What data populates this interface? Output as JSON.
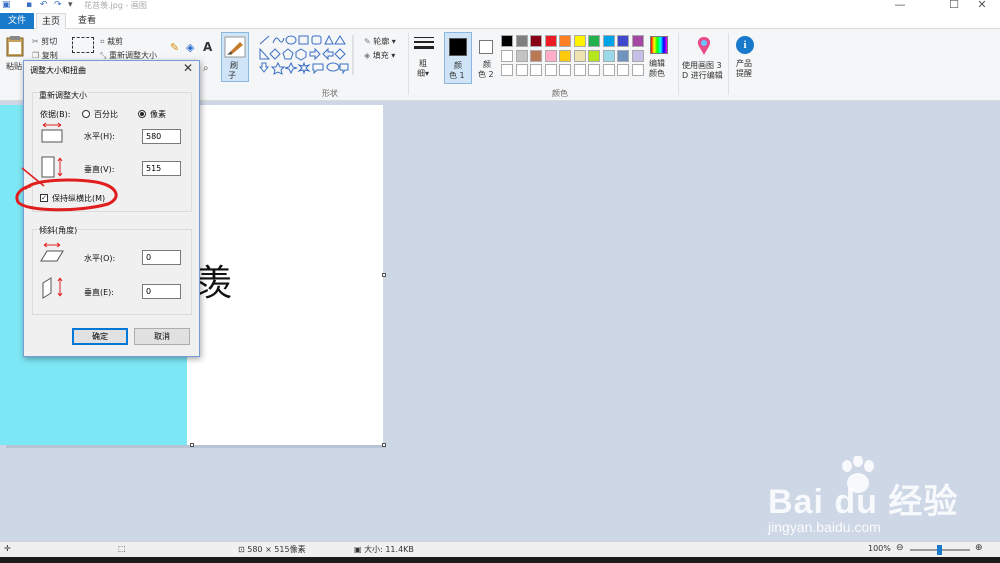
{
  "window": {
    "title": "花苔羡.jpg - 画图",
    "controls": {
      "minimize": "—",
      "maximize": "☐",
      "close": "✕"
    }
  },
  "tabs": [
    {
      "label": "文件"
    },
    {
      "label": "主页"
    },
    {
      "label": "查看"
    }
  ],
  "ribbon": {
    "clipboard": {
      "paste": "粘贴",
      "cut": "剪切",
      "copy": "复制"
    },
    "image": {
      "crop": "裁剪",
      "resize": "重新调整大小"
    },
    "brush": {
      "label": "刷",
      "label2": "子"
    },
    "shapes": {
      "group": "形状",
      "outline": "轮廓",
      "fill": "填充"
    },
    "size": {
      "label": "粗",
      "label2": "细"
    },
    "color1": {
      "label": "颜",
      "label2": "色 1"
    },
    "color2": {
      "label": "颜",
      "label2": "色 2"
    },
    "colors_group": "颜色",
    "edit_colors": {
      "label": "编辑",
      "label2": "颜色"
    },
    "paint3d": {
      "label": "使用画图 3",
      "label2": "D 进行编辑"
    },
    "tips": {
      "label": "产品",
      "label2": "提醒"
    },
    "palette_row1": [
      "#000000",
      "#7f7f7f",
      "#880015",
      "#ed1c24",
      "#ff7f27",
      "#fff200",
      "#22b14c",
      "#00a2e8",
      "#3f48cc",
      "#a349a4"
    ],
    "palette_row2": [
      "#ffffff",
      "#c3c3c3",
      "#b97a57",
      "#ffaec9",
      "#ffc90e",
      "#efe4b0",
      "#b5e61d",
      "#99d9ea",
      "#7092be",
      "#c8bfe7"
    ]
  },
  "canvas": {
    "text": "羡",
    "bg_color": "#7de8f5"
  },
  "dialog": {
    "title": "调整大小和扭曲",
    "close": "✕",
    "resize_group": "重新调整大小",
    "by_label": "依据(B):",
    "percent": "百分比",
    "pixels": "像素",
    "horizontal_label": "水平(H):",
    "horizontal_value": "580",
    "vertical_label": "垂直(V):",
    "vertical_value": "515",
    "keep_aspect": "保持纵横比(M)",
    "skew_group": "倾斜(角度)",
    "skew_h_label": "水平(O):",
    "skew_h_value": "0",
    "skew_v_label": "垂直(E):",
    "skew_v_value": "0",
    "ok": "确定",
    "cancel": "取消"
  },
  "status": {
    "dimensions": "580 × 515像素",
    "size": "大小: 11.4KB",
    "zoom": "100%"
  },
  "watermark": {
    "logo": "Bai du 经验",
    "url": "jingyan.baidu.com"
  }
}
